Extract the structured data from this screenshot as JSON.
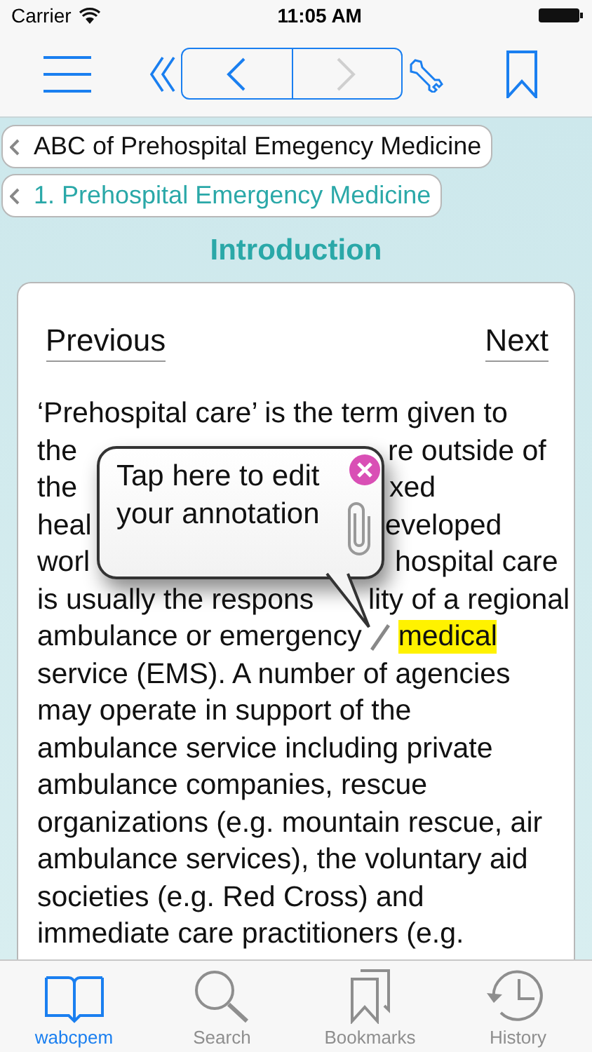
{
  "status_bar": {
    "carrier": "Carrier",
    "time": "11:05 AM"
  },
  "nav_buttons": [
    {
      "kind": "back",
      "disabled": false
    },
    {
      "kind": "forward",
      "disabled": true
    }
  ],
  "breadcrumbs": [
    {
      "label": "ABC of Prehospital Emegency Medicine",
      "current": false
    },
    {
      "label": "1. Prehospital Emergency Medicine",
      "current": true
    }
  ],
  "title": "Introduction",
  "pager": {
    "previous": "Previous",
    "next": "Next"
  },
  "lines": [
    {
      "kind": "text",
      "text": "‘Prehospital care’ is the term given to"
    },
    {
      "kind": "split",
      "left": "the",
      "right": "re outside of"
    },
    {
      "kind": "split",
      "left": "the",
      "right": "xed"
    },
    {
      "kind": "split",
      "left": "heal",
      "right": "eveloped"
    },
    {
      "kind": "split",
      "left": "worl",
      "right": "hospital care"
    },
    {
      "kind": "split",
      "left": "is usually the respons",
      "right": "lity of a regional"
    },
    {
      "kind": "annotated",
      "text": "ambulance or emergency",
      "highlight": "medical"
    },
    {
      "kind": "text",
      "text": "service (EMS). A number of agencies"
    },
    {
      "kind": "text",
      "text": "may operate in support of the"
    },
    {
      "kind": "text",
      "text": "ambulance service including private"
    },
    {
      "kind": "text",
      "text": "ambulance companies, rescue"
    },
    {
      "kind": "text",
      "text": "organizations (e.g. mountain rescue, air"
    },
    {
      "kind": "text",
      "text": "ambulance services), the voluntary aid"
    },
    {
      "kind": "text",
      "text": "societies (e.g. Red Cross) and"
    },
    {
      "kind": "text",
      "text": "immediate care practitioners (e.g."
    }
  ],
  "annotation": {
    "text": "Tap here to edit your annotation"
  },
  "tabs": [
    {
      "label": "wabcpem",
      "selected": true
    },
    {
      "label": "Search",
      "selected": false
    },
    {
      "label": "Bookmarks",
      "selected": false
    },
    {
      "label": "History",
      "selected": false
    }
  ]
}
